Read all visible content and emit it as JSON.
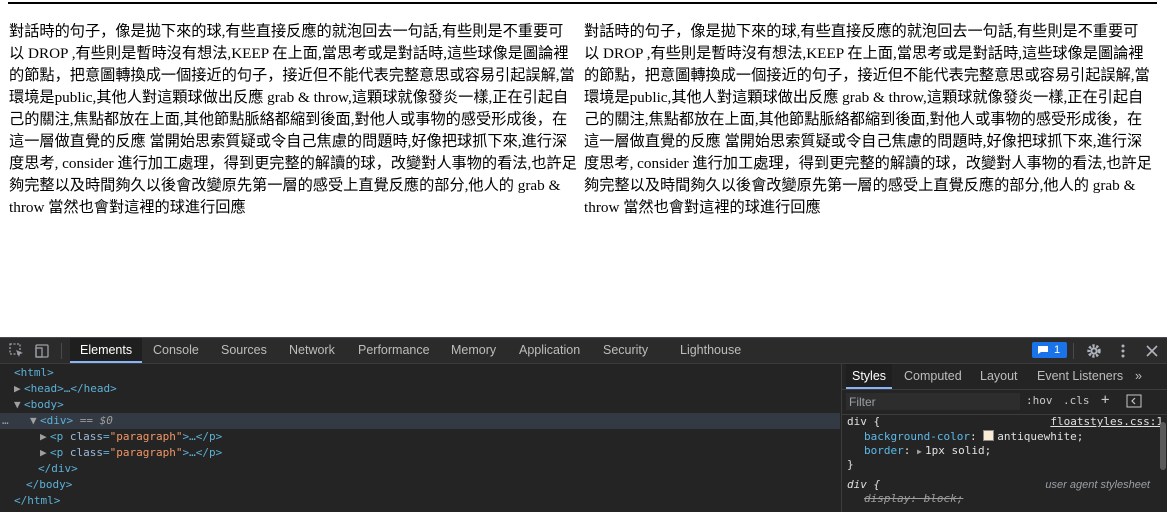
{
  "page": {
    "paragraph_1": "對話時的句子，像是拋下來的球,有些直接反應的就泡回去一句話,有些則是不重要可以 DROP ,有些則是暫時沒有想法,KEEP 在上面,當思考或是對話時,這些球像是圖論裡的節點，把意圖轉換成一個接近的句子，接近但不能代表完整意思或容易引起誤解,當環境是public,其他人對這顆球做出反應 grab & throw,這顆球就像發炎一樣,正在引起自己的關注,焦點都放在上面,其他節點脈絡都縮到後面,對他人或事物的感受形成後，在這一層做直覺的反應 當開始思索質疑或令自己焦慮的問題時,好像把球抓下來,進行深度思考, consider 進行加工處理，得到更完整的解讀的球，改變對人事物的看法,也許足夠完整以及時間夠久以後會改變原先第一層的感受上直覺反應的部分,他人的 grab & throw 當然也會對這裡的球進行回應",
    "paragraph_2": "對話時的句子，像是拋下來的球,有些直接反應的就泡回去一句話,有些則是不重要可以 DROP ,有些則是暫時沒有想法,KEEP 在上面,當思考或是對話時,這些球像是圖論裡的節點，把意圖轉換成一個接近的句子，接近但不能代表完整意思或容易引起誤解,當環境是public,其他人對這顆球做出反應 grab & throw,這顆球就像發炎一樣,正在引起自己的關注,焦點都放在上面,其他節點脈絡都縮到後面,對他人或事物的感受形成後，在這一層做直覺的反應 當開始思索質疑或令自己焦慮的問題時,好像把球抓下來,進行深度思考, consider 進行加工處理，得到更完整的解讀的球，改變對人事物的看法,也許足夠完整以及時間夠久以後會改變原先第一層的感受上直覺反應的部分,他人的 grab & throw 當然也會對這裡的球進行回應"
  },
  "devtools": {
    "tabs": [
      "Elements",
      "Console",
      "Sources",
      "Network",
      "Performance",
      "Memory",
      "Application",
      "Security",
      "Lighthouse"
    ],
    "active_tab": "Elements",
    "message_count": "1",
    "tree": {
      "html_open": "<html>",
      "head": "<head>…</head>",
      "body_open": "<body>",
      "div_open": "<div>",
      "div_eq": "==",
      "div_var": "$0",
      "p_tag_open": "<p",
      "p_attr_name": "class",
      "p_attr_value": "\"paragraph\"",
      "p_tag_close": ">…</p>",
      "div_close": "</div>",
      "body_close": "</body>",
      "html_close": "</html>",
      "ellipsis": "…"
    },
    "styles_tabs": [
      "Styles",
      "Computed",
      "Layout",
      "Event Listeners"
    ],
    "styles_active": "Styles",
    "more_tabs": "»",
    "filter_placeholder": "Filter",
    "hov": ":hov",
    "cls": ".cls",
    "plus": "+",
    "rule1": {
      "selector": "div {",
      "source": "floatstyles.css:1",
      "prop1": "background-color",
      "val1": "antiquewhite;",
      "swatch_color": "#faebd7",
      "prop2": "border",
      "val2": "1px solid;",
      "close": "}"
    },
    "rule2": {
      "selector": "div {",
      "source": "user agent stylesheet",
      "prop1": "display",
      "val1": "block;"
    }
  }
}
